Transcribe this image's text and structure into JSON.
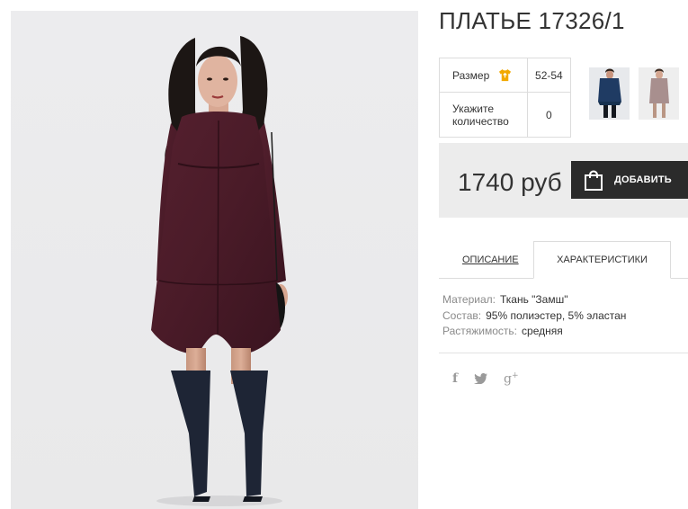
{
  "product": {
    "title": "ПЛАТЬЕ 17326/1",
    "photo_icon": "dress-photo"
  },
  "options": {
    "size_label": "Размер",
    "size_icon": "tshirt-icon",
    "size_value": "52-54",
    "qty_label": "Укажите количество",
    "qty_value": "0"
  },
  "thumbnails": [
    {
      "name": "thumb-navy-dress"
    },
    {
      "name": "thumb-grey-dress"
    }
  ],
  "price": {
    "amount": "1740 руб",
    "add_button": "ДОБАВИТЬ",
    "bag_icon": "shopping-bag-icon"
  },
  "tabs": {
    "description": "ОПИСАНИЕ",
    "characteristics": "ХАРАКТЕРИСТИКИ",
    "active": "characteristics"
  },
  "specs": [
    {
      "key": "Материал:",
      "value": "Ткань \"Замш\""
    },
    {
      "key": "Состав:",
      "value": "95% полиэстер, 5% эластан"
    },
    {
      "key": "Растяжимость:",
      "value": "средняя"
    }
  ],
  "social": {
    "facebook": "f",
    "google": "g"
  },
  "colors": {
    "dress": "#4a1d2a",
    "boots": "#1e2535",
    "button_bg": "#2b2b2b",
    "price_bg": "#ececec",
    "accent_icon": "#f2a900"
  }
}
